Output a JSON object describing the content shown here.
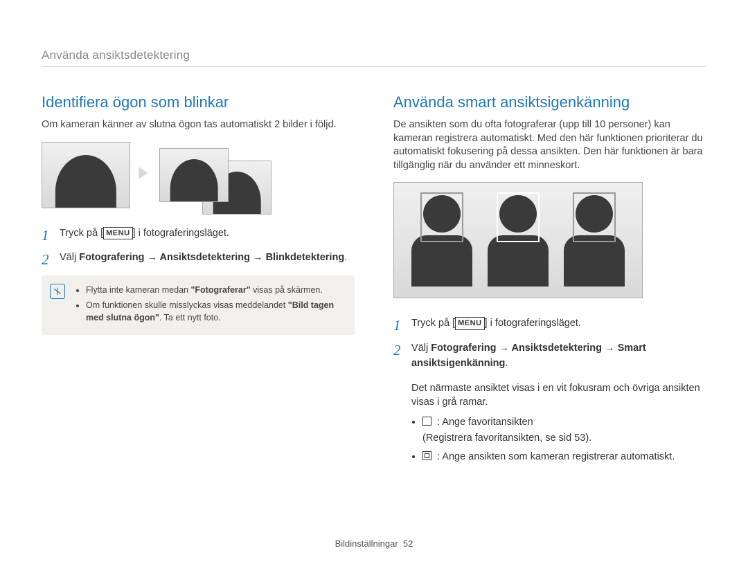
{
  "breadcrumb": "Använda ansiktsdetektering",
  "left": {
    "title": "Identifiera ögon som blinkar",
    "intro": "Om kameran känner av slutna ögon tas automatiskt 2 bilder i följd.",
    "step1_pre": "Tryck på [",
    "menu_label": "MENU",
    "step1_post": "] i fotograferingsläget.",
    "step2_pre": "Välj ",
    "step2_bold": "Fotografering → Ansiktsdetektering → Blinkdetektering",
    "step2_post": ".",
    "note1_pre": "Flytta inte kameran medan ",
    "note1_q": "\"Fotograferar\"",
    "note1_post": " visas på skärmen.",
    "note2_pre": "Om funktionen skulle misslyckas visas meddelandet ",
    "note2_q": "\"Bild tagen med slutna ögon\"",
    "note2_post": ". Ta ett nytt foto."
  },
  "right": {
    "title": "Använda smart ansiktsigenkänning",
    "intro": "De ansikten som du ofta fotograferar (upp till 10 personer) kan kameran registrera automatiskt. Med den här funktionen prioriterar du automatiskt fokusering på dessa ansikten. Den här funktionen är bara tillgänglig när du använder ett minneskort.",
    "step1_pre": "Tryck på [",
    "menu_label": "MENU",
    "step1_post": "] i fotograferingsläget.",
    "step2_pre": "Välj ",
    "step2_bold": "Fotografering → Ansiktsdetektering → Smart ansiktsigenkänning",
    "step2_post": ".",
    "after": "Det närmaste ansiktet visas i en vit fokusram och övriga ansikten visas i grå ramar.",
    "sym1_text": " : Ange favoritansikten",
    "sym1_sub": "(Registrera favoritansikten, se sid 53).",
    "sym2_text": " : Ange ansikten som kameran registrerar automatiskt."
  },
  "footer_label": "Bildinställningar",
  "footer_page": "52"
}
